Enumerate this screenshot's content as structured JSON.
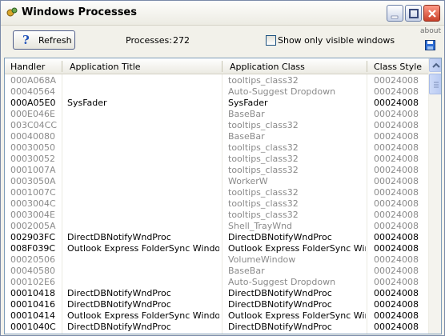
{
  "window": {
    "title": "Windows Processes"
  },
  "toolbar": {
    "refresh_label": "Refresh",
    "processes_label": "Processes:",
    "processes_count": "272",
    "visible_only_label": "Show only visible windows",
    "visible_only_checked": false,
    "about_label": "about"
  },
  "table": {
    "columns": [
      "Handler",
      "Application Title",
      "Application Class",
      "Class Style"
    ],
    "rows": [
      {
        "handler": "000A068A",
        "title": "",
        "class": "tooltips_class32",
        "style": "00024008",
        "visible": false
      },
      {
        "handler": "00040564",
        "title": "",
        "class": "Auto-Suggest Dropdown",
        "style": "00024008",
        "visible": false
      },
      {
        "handler": "000A05E0",
        "title": "SysFader",
        "class": "SysFader",
        "style": "00024008",
        "visible": true
      },
      {
        "handler": "000E046E",
        "title": "",
        "class": "BaseBar",
        "style": "00024008",
        "visible": false
      },
      {
        "handler": "003C04CC",
        "title": "",
        "class": "tooltips_class32",
        "style": "00024008",
        "visible": false
      },
      {
        "handler": "00040080",
        "title": "",
        "class": "BaseBar",
        "style": "00024008",
        "visible": false
      },
      {
        "handler": "00030050",
        "title": "",
        "class": "tooltips_class32",
        "style": "00024008",
        "visible": false
      },
      {
        "handler": "00030052",
        "title": "",
        "class": "tooltips_class32",
        "style": "00024008",
        "visible": false
      },
      {
        "handler": "0001007A",
        "title": "",
        "class": "tooltips_class32",
        "style": "00024008",
        "visible": false
      },
      {
        "handler": "0003050A",
        "title": "",
        "class": "WorkerW",
        "style": "00024008",
        "visible": false
      },
      {
        "handler": "0001007C",
        "title": "",
        "class": "tooltips_class32",
        "style": "00024008",
        "visible": false
      },
      {
        "handler": "0003004C",
        "title": "",
        "class": "tooltips_class32",
        "style": "00024008",
        "visible": false
      },
      {
        "handler": "0003004E",
        "title": "",
        "class": "tooltips_class32",
        "style": "00024008",
        "visible": false
      },
      {
        "handler": "0002005A",
        "title": "",
        "class": "Shell_TrayWnd",
        "style": "00024008",
        "visible": false
      },
      {
        "handler": "002903FC",
        "title": "DirectDBNotifyWndProc",
        "class": "DirectDBNotifyWndProc",
        "style": "00024008",
        "visible": true
      },
      {
        "handler": "008F039C",
        "title": "Outlook Express FolderSync Window ...",
        "class": "Outlook Express FolderSync Win...",
        "style": "00024008",
        "visible": true
      },
      {
        "handler": "00020506",
        "title": "",
        "class": "VolumeWindow",
        "style": "00024008",
        "visible": false
      },
      {
        "handler": "00040580",
        "title": "",
        "class": "BaseBar",
        "style": "00024008",
        "visible": false
      },
      {
        "handler": "000102E6",
        "title": "",
        "class": "Auto-Suggest Dropdown",
        "style": "00024008",
        "visible": false
      },
      {
        "handler": "00010418",
        "title": "DirectDBNotifyWndProc",
        "class": "DirectDBNotifyWndProc",
        "style": "00024008",
        "visible": true
      },
      {
        "handler": "00010416",
        "title": "DirectDBNotifyWndProc",
        "class": "DirectDBNotifyWndProc",
        "style": "00024008",
        "visible": true
      },
      {
        "handler": "00010414",
        "title": "Outlook Express FolderSync Window ...",
        "class": "Outlook Express FolderSync Win...",
        "style": "00024008",
        "visible": true
      },
      {
        "handler": "0001040C",
        "title": "DirectDBNotifyWndProc",
        "class": "DirectDBNotifyWndProc",
        "style": "00024008",
        "visible": true
      }
    ]
  },
  "colors": {
    "visible_text": "#000000",
    "hidden_text": "#8a8a8a",
    "accent": "#1d4fb8"
  }
}
